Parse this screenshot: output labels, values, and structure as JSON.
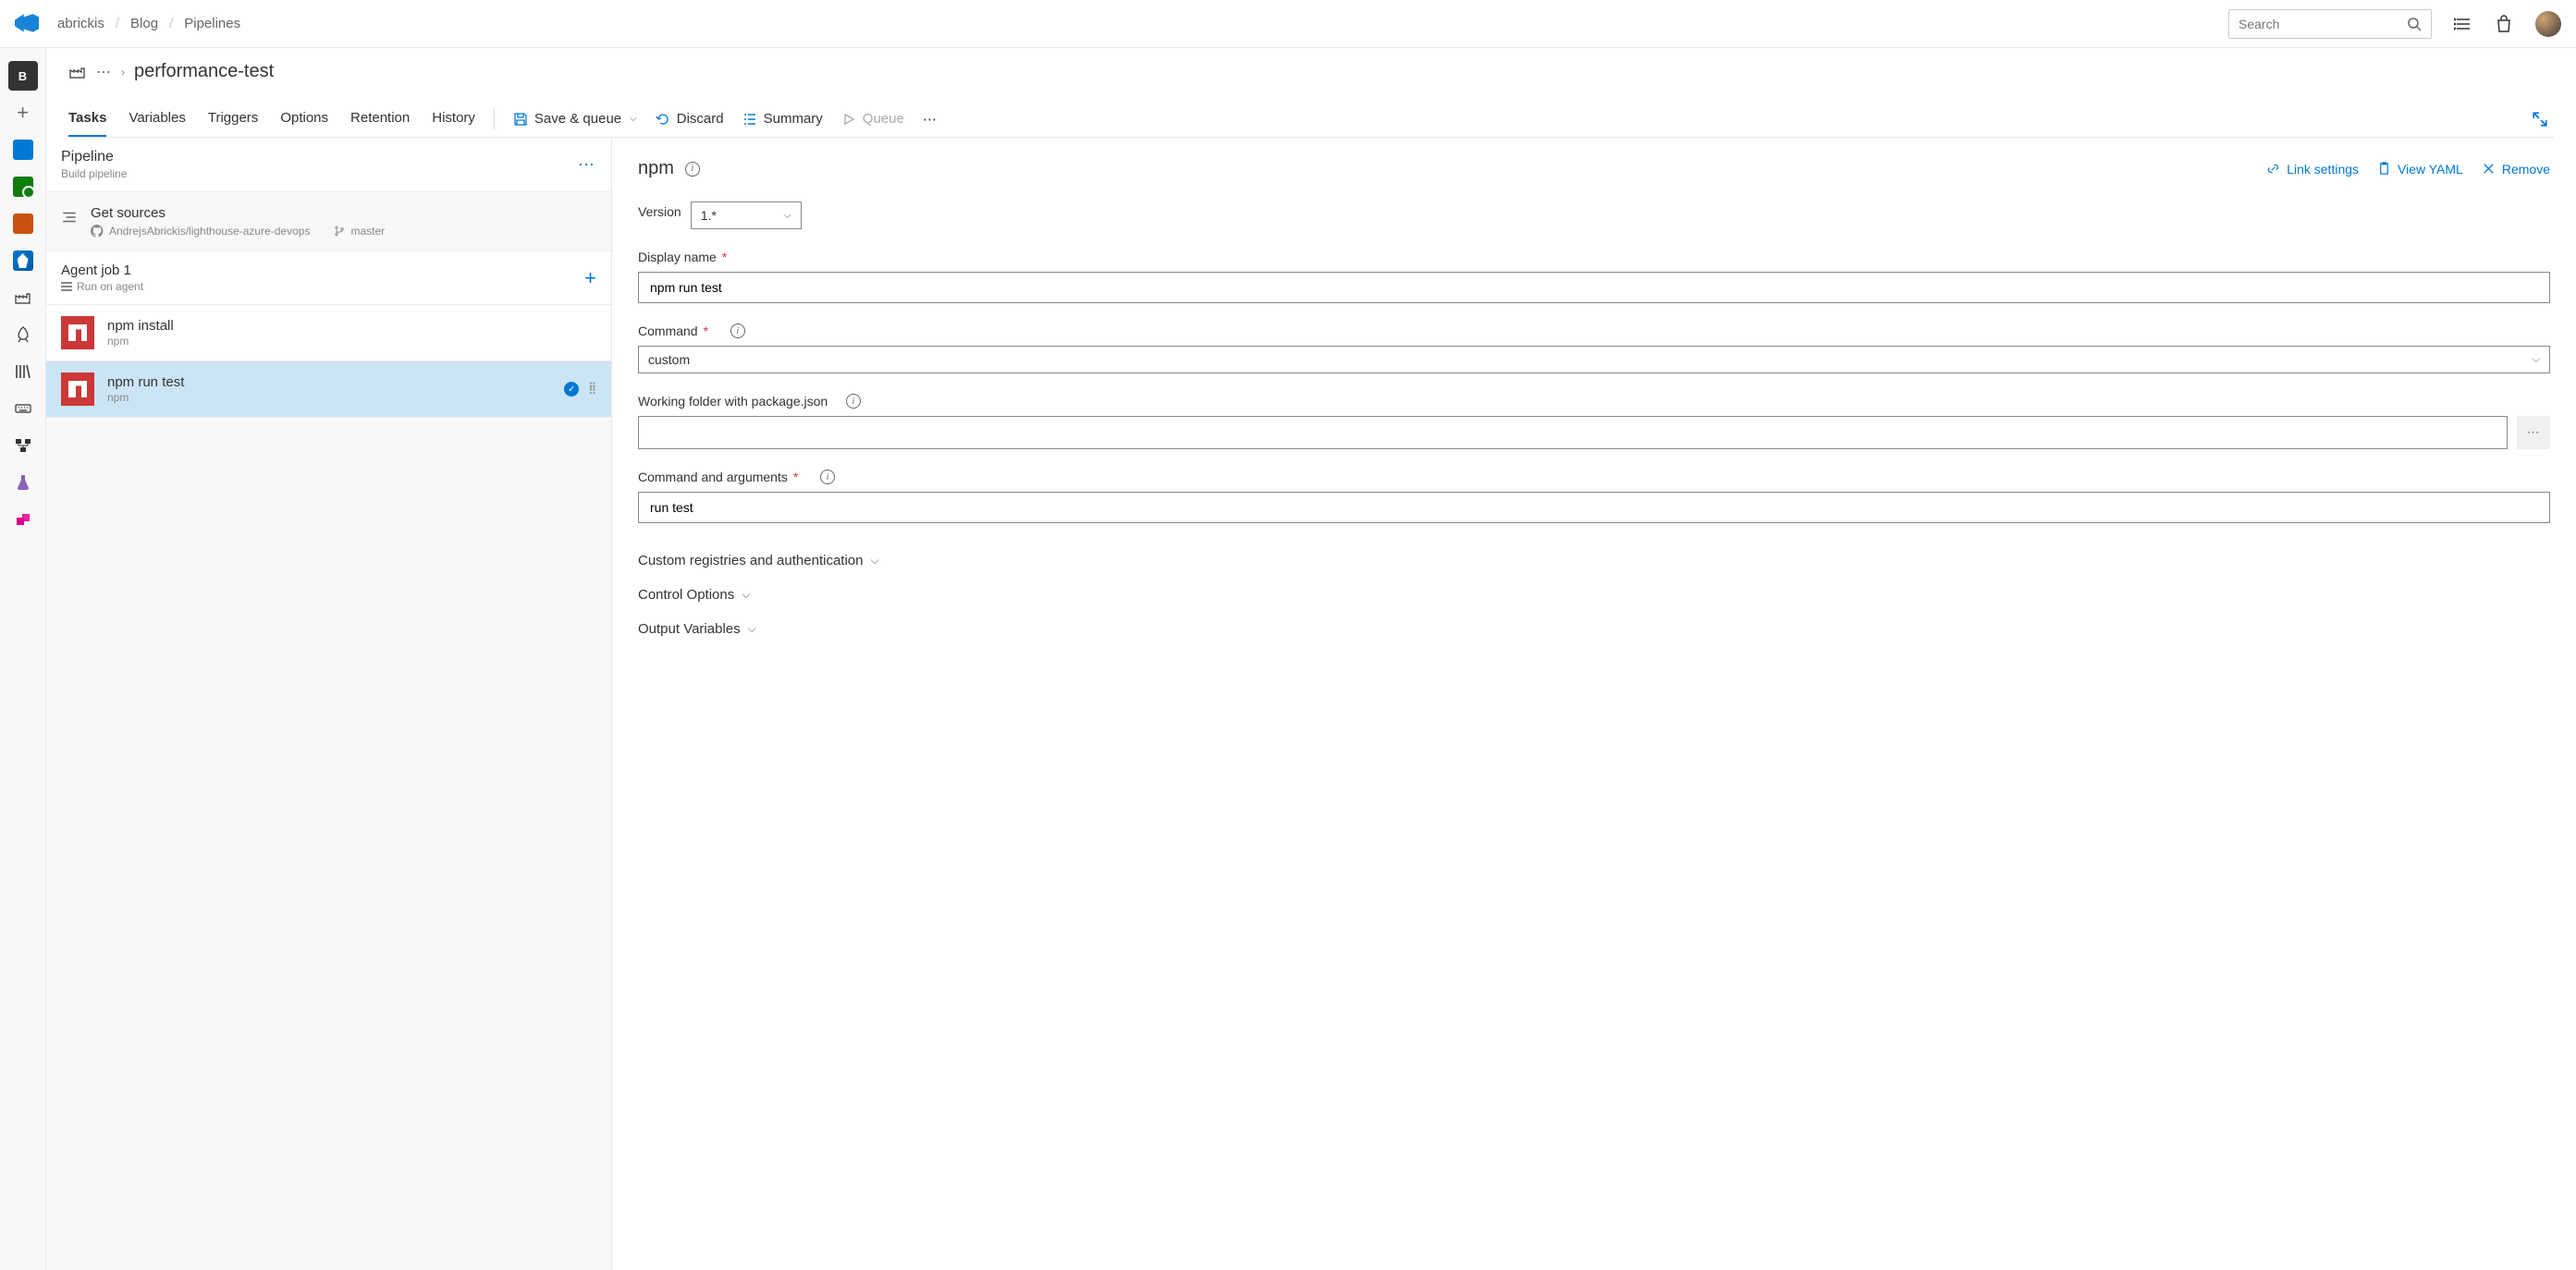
{
  "header": {
    "breadcrumb": [
      "abrickis",
      "Blog",
      "Pipelines"
    ],
    "search_placeholder": "Search"
  },
  "sidebar_rail": {
    "project_initial": "B"
  },
  "page": {
    "breadcrumb_dots": "⋯",
    "title": "performance-test",
    "tabs": [
      "Tasks",
      "Variables",
      "Triggers",
      "Options",
      "Retention",
      "History"
    ],
    "active_tab_index": 0,
    "actions": {
      "save_queue": "Save & queue",
      "discard": "Discard",
      "summary": "Summary",
      "queue": "Queue",
      "more": "⋯"
    }
  },
  "pipeline_pane": {
    "pipeline_title": "Pipeline",
    "pipeline_sub": "Build pipeline",
    "sources_title": "Get sources",
    "sources_repo": "AndrejsAbrickis/lighthouse-azure-devops",
    "sources_branch": "master",
    "job_title": "Agent job 1",
    "job_sub": "Run on agent",
    "tasks": [
      {
        "name": "npm install",
        "type": "npm",
        "selected": false
      },
      {
        "name": "npm run test",
        "type": "npm",
        "selected": true
      }
    ]
  },
  "form": {
    "title": "npm",
    "actions": {
      "link": "Link settings",
      "yaml": "View YAML",
      "remove": "Remove"
    },
    "version_label": "Version",
    "version_value": "1.*",
    "display_name_label": "Display name",
    "display_name_value": "npm run test",
    "command_label": "Command",
    "command_value": "custom",
    "working_folder_label": "Working folder with package.json",
    "working_folder_value": "",
    "args_label": "Command and arguments",
    "args_value": "run test",
    "sections": [
      "Custom registries and authentication",
      "Control Options",
      "Output Variables"
    ]
  }
}
